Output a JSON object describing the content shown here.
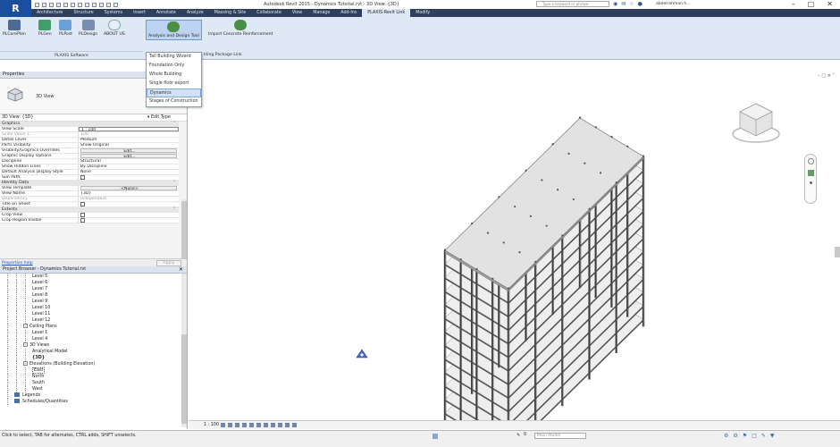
{
  "titlebar": {
    "title": "Autodesk Revit 2015 -   Dynamics Tutorial.rvt - 3D View: {3D}",
    "search_placeholder": "Type a keyword or phrase",
    "user": "abdelrahman.h...",
    "help": "?"
  },
  "app_logo": "R",
  "tabs": [
    "Architecture",
    "Structure",
    "Systems",
    "Insert",
    "Annotate",
    "Analyze",
    "Massing & Site",
    "Collaborate",
    "View",
    "Manage",
    "Add-Ins",
    "PLAXIS-Revit Link",
    "Modify"
  ],
  "active_tab_index": 11,
  "ribbon": {
    "buttons": [
      "PLCorePlan",
      "PLGen",
      "PLPost",
      "PLDesign",
      "ABOUT US",
      "Analysis and Design Tool",
      "Import Concrete Reinforcement"
    ],
    "panel_label": "PLAXIS Software",
    "bim_link": "lding Package Link"
  },
  "dropdown": {
    "items": [
      "Tall Building Wizard",
      "Foundation Only",
      "Whole Building",
      "Single floor export",
      "Dynamics",
      "Stages of Construction"
    ],
    "highlighted_index": 4
  },
  "properties": {
    "header": "Properties",
    "type_label": "3D View",
    "instance_label": "3D View: {3D}",
    "edit_type": "Edit Type",
    "categories": [
      {
        "name": "Graphics",
        "rows": [
          {
            "k": "View Scale",
            "v": "1 : 100"
          },
          {
            "k": "Scale Value    1:",
            "v": "100"
          },
          {
            "k": "Detail Level",
            "v": "Medium"
          },
          {
            "k": "Parts Visibility",
            "v": "Show Original"
          },
          {
            "k": "Visibility/Graphics Overrides",
            "v": "Edit..."
          },
          {
            "k": "Graphic Display Options",
            "v": "Edit..."
          },
          {
            "k": "Discipline",
            "v": "Structural"
          },
          {
            "k": "Show Hidden Lines",
            "v": "By Discipline"
          },
          {
            "k": "Default Analysis Display Style",
            "v": "None"
          },
          {
            "k": "Sun Path",
            "v": ""
          }
        ]
      },
      {
        "name": "Identity Data",
        "rows": [
          {
            "k": "View Template",
            "v": "<None>"
          },
          {
            "k": "View Name",
            "v": "{3D}"
          },
          {
            "k": "Dependency",
            "v": "Independent"
          },
          {
            "k": "Title on Sheet",
            "v": ""
          }
        ]
      },
      {
        "name": "Extents",
        "rows": [
          {
            "k": "Crop View",
            "v": ""
          },
          {
            "k": "Crop Region Visible",
            "v": ""
          }
        ]
      }
    ],
    "help_link": "Properties help",
    "apply": "Apply"
  },
  "browser": {
    "header": "Project Browser - Dynamics Tutorial.rvt",
    "nodes": [
      {
        "label": "Level 5",
        "depth": 3,
        "expander": ""
      },
      {
        "label": "Level 6",
        "depth": 3,
        "expander": ""
      },
      {
        "label": "Level 7",
        "depth": 3,
        "expander": ""
      },
      {
        "label": "Level 8",
        "depth": 3,
        "expander": ""
      },
      {
        "label": "Level 9",
        "depth": 3,
        "expander": ""
      },
      {
        "label": "Level 10",
        "depth": 3,
        "expander": ""
      },
      {
        "label": "Level 11",
        "depth": 3,
        "expander": ""
      },
      {
        "label": "Level 12",
        "depth": 3,
        "expander": ""
      },
      {
        "label": "Ceiling Plans",
        "depth": 2,
        "expander": "-"
      },
      {
        "label": "Level 1",
        "depth": 3,
        "expander": ""
      },
      {
        "label": "Level 4",
        "depth": 3,
        "expander": ""
      },
      {
        "label": "3D Views",
        "depth": 2,
        "expander": "-"
      },
      {
        "label": "Analytical Model",
        "depth": 3,
        "expander": ""
      },
      {
        "label": "{3D}",
        "depth": 3,
        "expander": "",
        "bold": true
      },
      {
        "label": "Elevations (Building Elevation)",
        "depth": 2,
        "expander": "-"
      },
      {
        "label": "East",
        "depth": 3,
        "expander": "",
        "selected": true
      },
      {
        "label": "North",
        "depth": 3,
        "expander": ""
      },
      {
        "label": "South",
        "depth": 3,
        "expander": ""
      },
      {
        "label": "West",
        "depth": 3,
        "expander": ""
      },
      {
        "label": "Legends",
        "depth": 1,
        "expander": ""
      },
      {
        "label": "Schedules/Quantities",
        "depth": 1,
        "expander": ""
      }
    ]
  },
  "view": {
    "controls": "– □ ✕ ˄",
    "scale": "1 : 100",
    "building_levels": 12
  },
  "status": {
    "text": "Click to select, TAB for alternates, CTRL adds, SHIFT unselects.",
    "model": "Main Model",
    "filter_count": "0"
  },
  "colors": {
    "tab_bar": "#2f3f5c",
    "ribbon": "#dfe8f5",
    "highlight": "#cfe1f7",
    "link": "#1a56b8"
  }
}
